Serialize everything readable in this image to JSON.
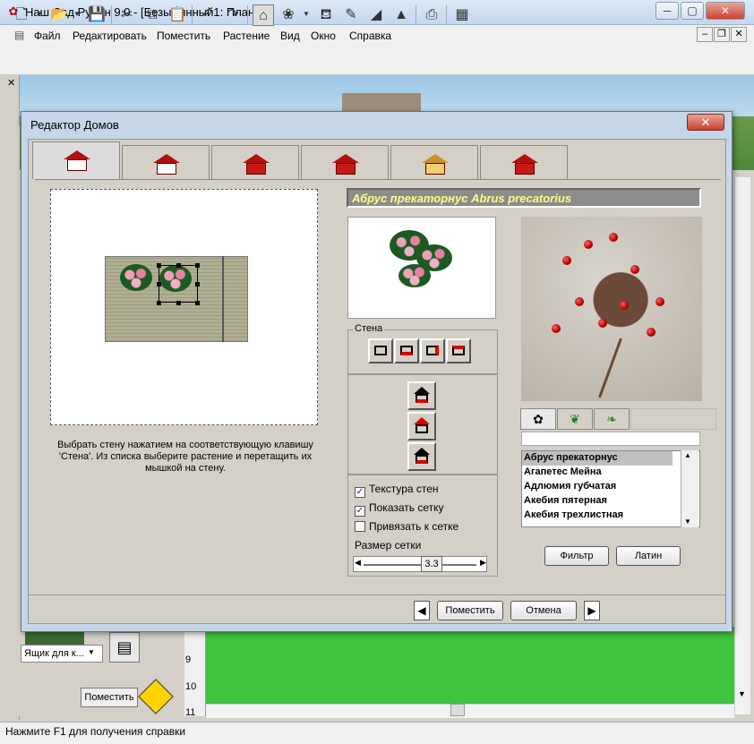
{
  "app": {
    "title": "Наш Сад Рубин 9.0 - [Безымянный1: План]"
  },
  "window_controls": {
    "minimize": "─",
    "maximize": "▢",
    "close": "✕"
  },
  "mdi_controls": {
    "minimize": "–",
    "restore": "❐",
    "close": "✕"
  },
  "menu": [
    "Файл",
    "Редактировать",
    "Поместить",
    "Растение",
    "Вид",
    "Окно",
    "Справка"
  ],
  "toolbar": {
    "icons": [
      "new-icon",
      "open-icon",
      "save-icon",
      "cut-icon",
      "copy-icon",
      "paste-icon",
      "undo-icon",
      "redo-icon",
      "house-editor-icon",
      "flower-icon",
      "watering-can-icon",
      "notes-icon",
      "terrain-icon",
      "tree-icon",
      "print-icon",
      "calculator-icon"
    ]
  },
  "dialog": {
    "title": "Редактор Домов",
    "close": "✕",
    "instruction": "Выбрать стену нажатием на соответствующую клавишу 'Стена'. Из списка выберите растение  и перетащить их мышкой на стену.",
    "plant_name": "Абрус прекаторнус Abrus precatorius",
    "wall_group_label": "Стена",
    "checkboxes": [
      {
        "label": "Текстура стен",
        "checked": true
      },
      {
        "label": "Показать сетку",
        "checked": true
      },
      {
        "label": "Привязать к сетке",
        "checked": false
      }
    ],
    "check_mark": "✓",
    "grid_size_label": "Размер сетки",
    "grid_size_value": "3.3",
    "plant_list": [
      "Абрус прекаторнус",
      "Агапетес Мейна",
      "Адлюмия губчатая",
      "Акебия пятерная",
      "Акебия трехлистная"
    ],
    "selected_plant_index": 0,
    "filter_button": "Фильтр",
    "latin_button": "Латин",
    "place_button": "Поместить",
    "cancel_button": "Отмена",
    "prev_arrow": "◀",
    "next_arrow": "▶"
  },
  "left_panel": {
    "combo_value": "Ящик для к...",
    "place_button": "Поместить"
  },
  "ruler": [
    "9",
    "10",
    "11"
  ],
  "status": "Нажмите F1 для получения справки",
  "colors": {
    "dialog_frame": "#c6d6e8",
    "grass": "#3ec43e",
    "plant_name_text": "#ffff80"
  }
}
